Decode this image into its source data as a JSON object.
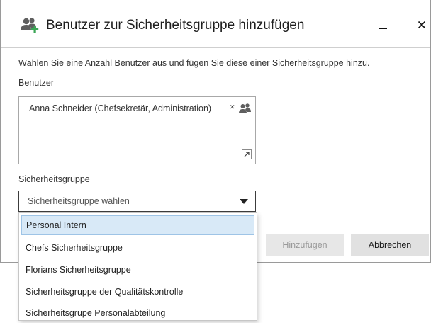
{
  "dialog": {
    "title": "Benutzer zur Sicherheitsgruppe hinzufügen",
    "title_icon": "add-users-icon",
    "close_glyph": "✕",
    "instruction": "Wählen Sie eine Anzahl Benutzer aus und fügen Sie diese einer Sicherheitsgruppe hinzu."
  },
  "users_field": {
    "label": "Benutzer",
    "selected_user": "Anna Schneider (Chefsekretär, Administration)",
    "remove_glyph": "✕",
    "pick_icon": "users-picker-icon",
    "expand_icon": "expand-icon"
  },
  "group_field": {
    "label": "Sicherheitsgruppe",
    "placeholder": "Sicherheitsgruppe wählen",
    "options": [
      "Personal Intern",
      "Chefs Sicherheitsgruppe",
      "Florians Sicherheitsgruppe",
      "Sicherheitsgruppe der Qualitätskontrolle",
      "Sicherheitsgrupe Personalabteilung"
    ],
    "highlighted_index": 0
  },
  "buttons": {
    "add_label": "Hinzufügen",
    "cancel_label": "Abbrechen"
  },
  "colors": {
    "accent_green": "#3aa655",
    "icon_gray": "#5f5f5f",
    "highlight": "#d8e9f7"
  }
}
